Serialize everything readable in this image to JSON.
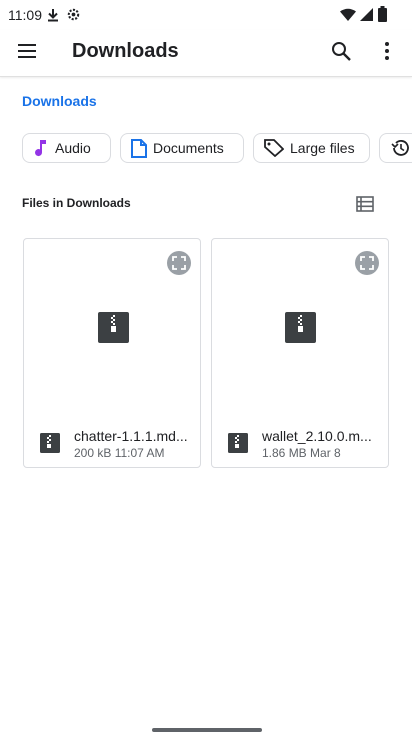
{
  "status_bar": {
    "time": "11:09",
    "icons": [
      "download-icon",
      "settings-gear-icon",
      "wifi-icon",
      "cell-signal-icon",
      "battery-icon"
    ]
  },
  "app_bar": {
    "title": "Downloads",
    "icons": [
      "menu-icon",
      "search-icon",
      "more-vert-icon"
    ]
  },
  "breadcrumb": "Downloads",
  "chips": [
    {
      "label": "Audio",
      "icon": "music-note-icon"
    },
    {
      "label": "Documents",
      "icon": "document-icon"
    },
    {
      "label": "Large files",
      "icon": "label-tag-icon"
    },
    {
      "label": "",
      "icon": "history-icon"
    }
  ],
  "section": {
    "title": "Files in Downloads",
    "view_toggle_icon": "list-view-icon"
  },
  "files": [
    {
      "name": "chatter-1.1.1.md...",
      "meta": "200 kB 11:07 AM",
      "icon": "archive-zip-icon"
    },
    {
      "name": "wallet_2.10.0.m...",
      "meta": "1.86 MB Mar 8",
      "icon": "archive-zip-icon"
    }
  ],
  "colors": {
    "accent": "#1a73e8",
    "audio_icon": "#9334e6",
    "document_icon": "#1a73e8",
    "text": "#202124",
    "secondary_text": "#5f6368"
  }
}
